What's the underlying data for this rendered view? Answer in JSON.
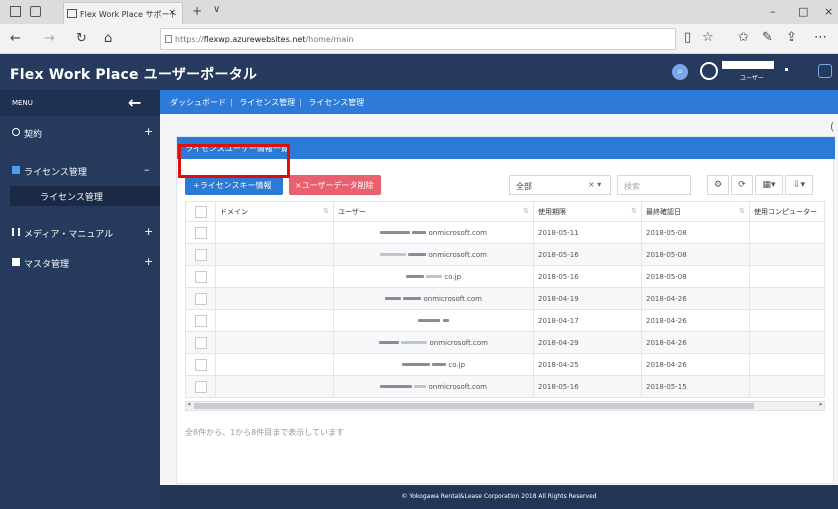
{
  "browser": {
    "tab_title": "Flex Work Place サポート",
    "tab_close": "×",
    "new_tab": "+",
    "tab_list": "∨",
    "url_prefix": "https://",
    "url_host": "flexwp.azurewebsites.net",
    "url_path": "/home/main",
    "window_min": "–",
    "window_max": "□",
    "window_close": "×"
  },
  "app": {
    "title": "Flex Work Place ユーザーポータル",
    "user_sub": "ユーザー"
  },
  "sidebar": {
    "menu_label": "MENU",
    "back_icon": "←",
    "items": [
      {
        "label": "契約",
        "sign": "+"
      },
      {
        "label": "ライセンス管理",
        "sign": "–"
      },
      {
        "label": "メディア・マニュアル",
        "sign": "+"
      },
      {
        "label": "マスタ管理",
        "sign": "+"
      }
    ],
    "subitem": "ライセンス管理"
  },
  "breadcrumb": [
    "ダッシュボード",
    "ライセンス管理",
    "ライセンス管理"
  ],
  "card": {
    "title": "ライセンスユーザー情報一覧",
    "btn_license_key": "+ライセンスキー情報",
    "btn_delete": "×ユーザーデータ削除",
    "filter_value": "全部",
    "filter_clear": "× ▾",
    "search_placeholder": "検索",
    "tool_buttons": [
      "⚙",
      "⟳",
      "▦▾",
      "⇩▾"
    ]
  },
  "table": {
    "columns": [
      "ドメイン",
      "ユーザー",
      "使用期限",
      "最終確認日",
      "使用コンピューター"
    ],
    "rows": [
      {
        "user": "onmicrosoft.com",
        "expiry": "2018-05-11",
        "checked": "2018-05-08"
      },
      {
        "user": "onmicrosoft.com",
        "expiry": "2018-05-16",
        "checked": "2018-05-08"
      },
      {
        "user": "co.jp",
        "expiry": "2018-05-16",
        "checked": "2018-05-08"
      },
      {
        "user": "onmicrosoft.com",
        "expiry": "2018-04-19",
        "checked": "2018-04-26"
      },
      {
        "user": "",
        "expiry": "2018-04-17",
        "checked": "2018-04-26"
      },
      {
        "user": "onmicrosoft.com",
        "expiry": "2018-04-29",
        "checked": "2018-04-26"
      },
      {
        "user": "co.jp",
        "expiry": "2018-04-25",
        "checked": "2018-04-26"
      },
      {
        "user": "onmicrosoft.com",
        "expiry": "2018-05-16",
        "checked": "2018-05-15"
      }
    ]
  },
  "footnote": "全8件から、1から8件目まで表示しています",
  "footer": "© Yokogawa Rental&Lease Corporation 2018 All Rights Reserved",
  "colors": {
    "header": "#253a5c",
    "accent": "#2a7ad6",
    "danger": "#e9616f",
    "highlight": "#e00d0d"
  }
}
